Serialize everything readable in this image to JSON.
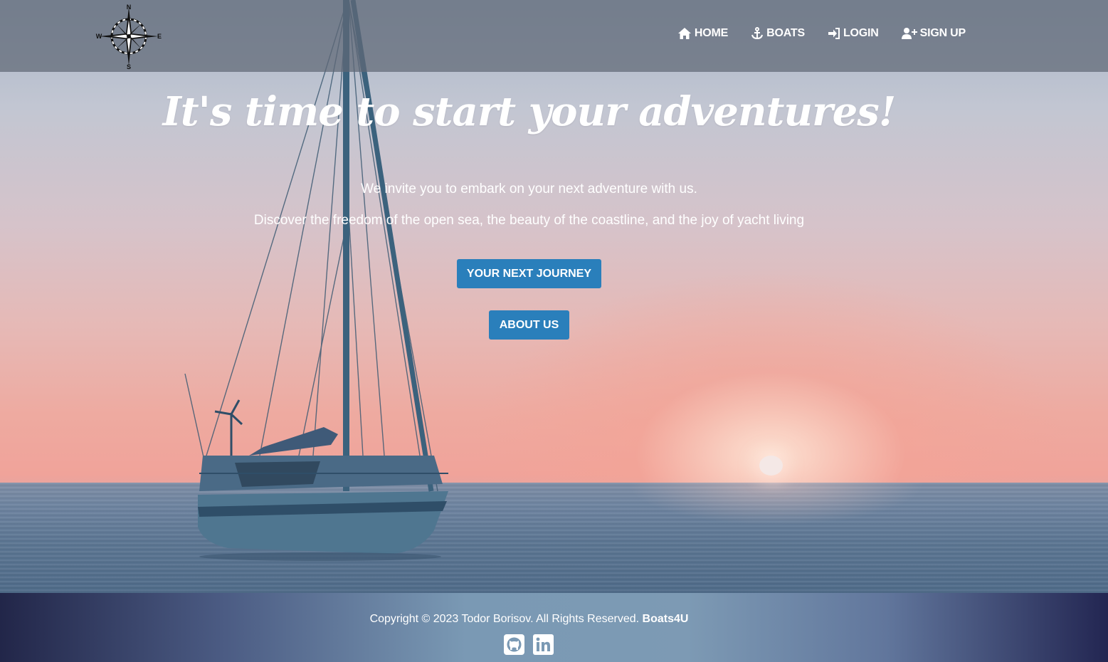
{
  "header": {
    "logo": {
      "icon": "compass-rose-icon",
      "north": "N",
      "south": "S",
      "east": "E",
      "west": "W"
    },
    "nav": [
      {
        "label": "HOME",
        "icon": "home-icon"
      },
      {
        "label": "BOATS",
        "icon": "anchor-icon"
      },
      {
        "label": "LOGIN",
        "icon": "login-icon"
      },
      {
        "label": "SIGN UP",
        "icon": "user-plus-icon"
      }
    ]
  },
  "hero": {
    "headline": "It's time to start your adventures!",
    "tagline_1": "We invite you to embark on your next adventure with us.",
    "tagline_2": "Discover the freedom of the open sea, the beauty of the coastline, and the joy of yacht living",
    "primary_button": "YOUR NEXT JOURNEY",
    "secondary_button": "ABOUT US"
  },
  "footer": {
    "copyright": "Copyright © 2023 Todor Borisov. All Rights Reserved.",
    "brand": "Boats4U",
    "social": [
      {
        "icon": "github-icon"
      },
      {
        "icon": "linkedin-icon"
      }
    ]
  },
  "colors": {
    "button": "#2a7fbb",
    "header_overlay": "#606876",
    "footer_edge": "#222649",
    "footer_center": "#7a99b4"
  }
}
